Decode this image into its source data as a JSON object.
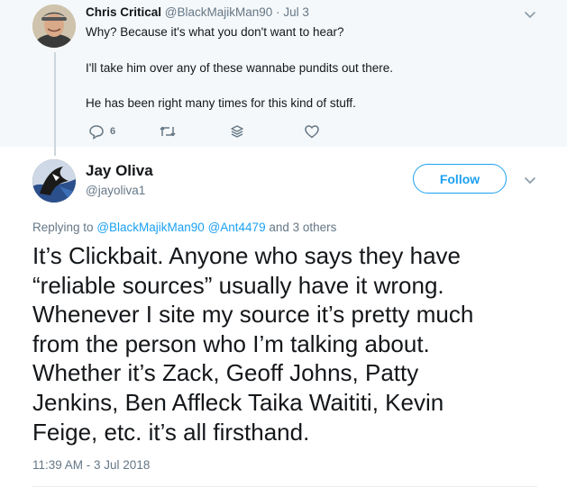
{
  "parent_tweet": {
    "author_name": "Chris Critical",
    "handle": "@BlackMajikMan90",
    "separator": "·",
    "date": "Jul 3",
    "lines": [
      "Why? Because it's what you don't want to hear?",
      "I'll take him over any of these wannabe pundits out there.",
      "He has been right many times for this kind of stuff."
    ],
    "actions": {
      "reply_count": "6",
      "icons": [
        "reply-icon",
        "retweet-icon",
        "direct-message-icon",
        "like-heart-icon"
      ]
    }
  },
  "main_tweet": {
    "author_name": "Jay Oliva",
    "handle": "@jayoliva1",
    "follow_label": "Follow",
    "replying_prefix": "Replying to",
    "mention_1": "@BlackMajikMan90",
    "mention_2": "@Ant4479",
    "replying_suffix": "and 3 others",
    "text_lines": [
      "It’s Clickbait. Anyone who says they have",
      "“reliable sources” usually have it wrong.",
      "Whenever I site my source it’s pretty much",
      "from the person who I’m talking about.",
      "Whether it’s Zack, Geoff Johns, Patty",
      "Jenkins, Ben Affleck Taika Waititi, Kevin",
      "Feige, etc.  it’s all firsthand."
    ],
    "timestamp": "11:39 AM - 3 Jul 2018"
  },
  "colors": {
    "accent": "#1da1f2",
    "secondary_text": "#657786",
    "primary_text": "#14171a",
    "context_background": "#f5f8fa"
  }
}
